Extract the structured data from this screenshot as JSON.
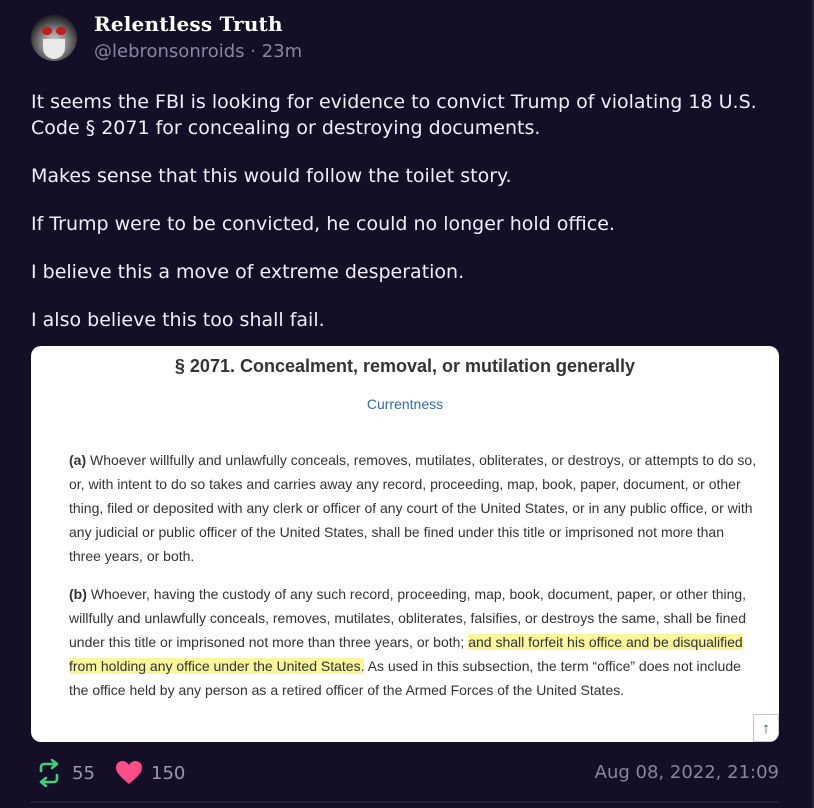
{
  "post": {
    "author": {
      "display_name": "Relentless Truth",
      "handle": "@lebronsonroids",
      "separator": "·",
      "time_ago": "23m"
    },
    "paragraphs": [
      "It seems the FBI is looking for evidence to convict Trump of violating 18 U.S. Code § 2071 for concealing or destroying documents.",
      "Makes sense that this would follow the toilet story.",
      "If Trump were to be convicted, he could no longer hold office.",
      "I believe this a move of extreme desperation.",
      "I also believe this too shall fail."
    ],
    "attachment": {
      "title": "§ 2071. Concealment, removal, or mutilation generally",
      "currentness": "Currentness",
      "para_a_mark": "(a)",
      "para_a_text": "Whoever willfully and unlawfully conceals, removes, mutilates, obliterates, or destroys, or attempts to do so, or, with intent to do so takes and carries away any record, proceeding, map, book, paper, document, or other thing, filed or deposited with any clerk or officer of any court of the United States, or in any public office, or with any judicial or public officer of the United States, shall be fined under this title or imprisoned not more than three years, or both.",
      "para_b_mark": "(b)",
      "para_b_text_before": "Whoever, having the custody of any such record, proceeding, map, book, document, paper, or other thing, willfully and unlawfully conceals, removes, mutilates, obliterates, falsifies, or destroys the same, shall be fined under this title or imprisoned not more than three years, or both;",
      "para_b_highlight": "and shall forfeit his office and be disqualified from holding any office under the United States.",
      "para_b_text_after": "As used in this subsection, the term “office” does not include the office held by any person as a retired officer of the Armed Forces of the United States.",
      "highlight_color": "#fbf59b",
      "scroll_icon": "arrow-up-icon"
    },
    "stats": {
      "retruths": "55",
      "likes": "150",
      "retruth_icon": "retruth-icon",
      "like_icon": "heart-icon",
      "retruth_color": "#3fd07a",
      "like_color": "#ff4d88"
    },
    "timestamp": "Aug 08, 2022, 21:09"
  }
}
